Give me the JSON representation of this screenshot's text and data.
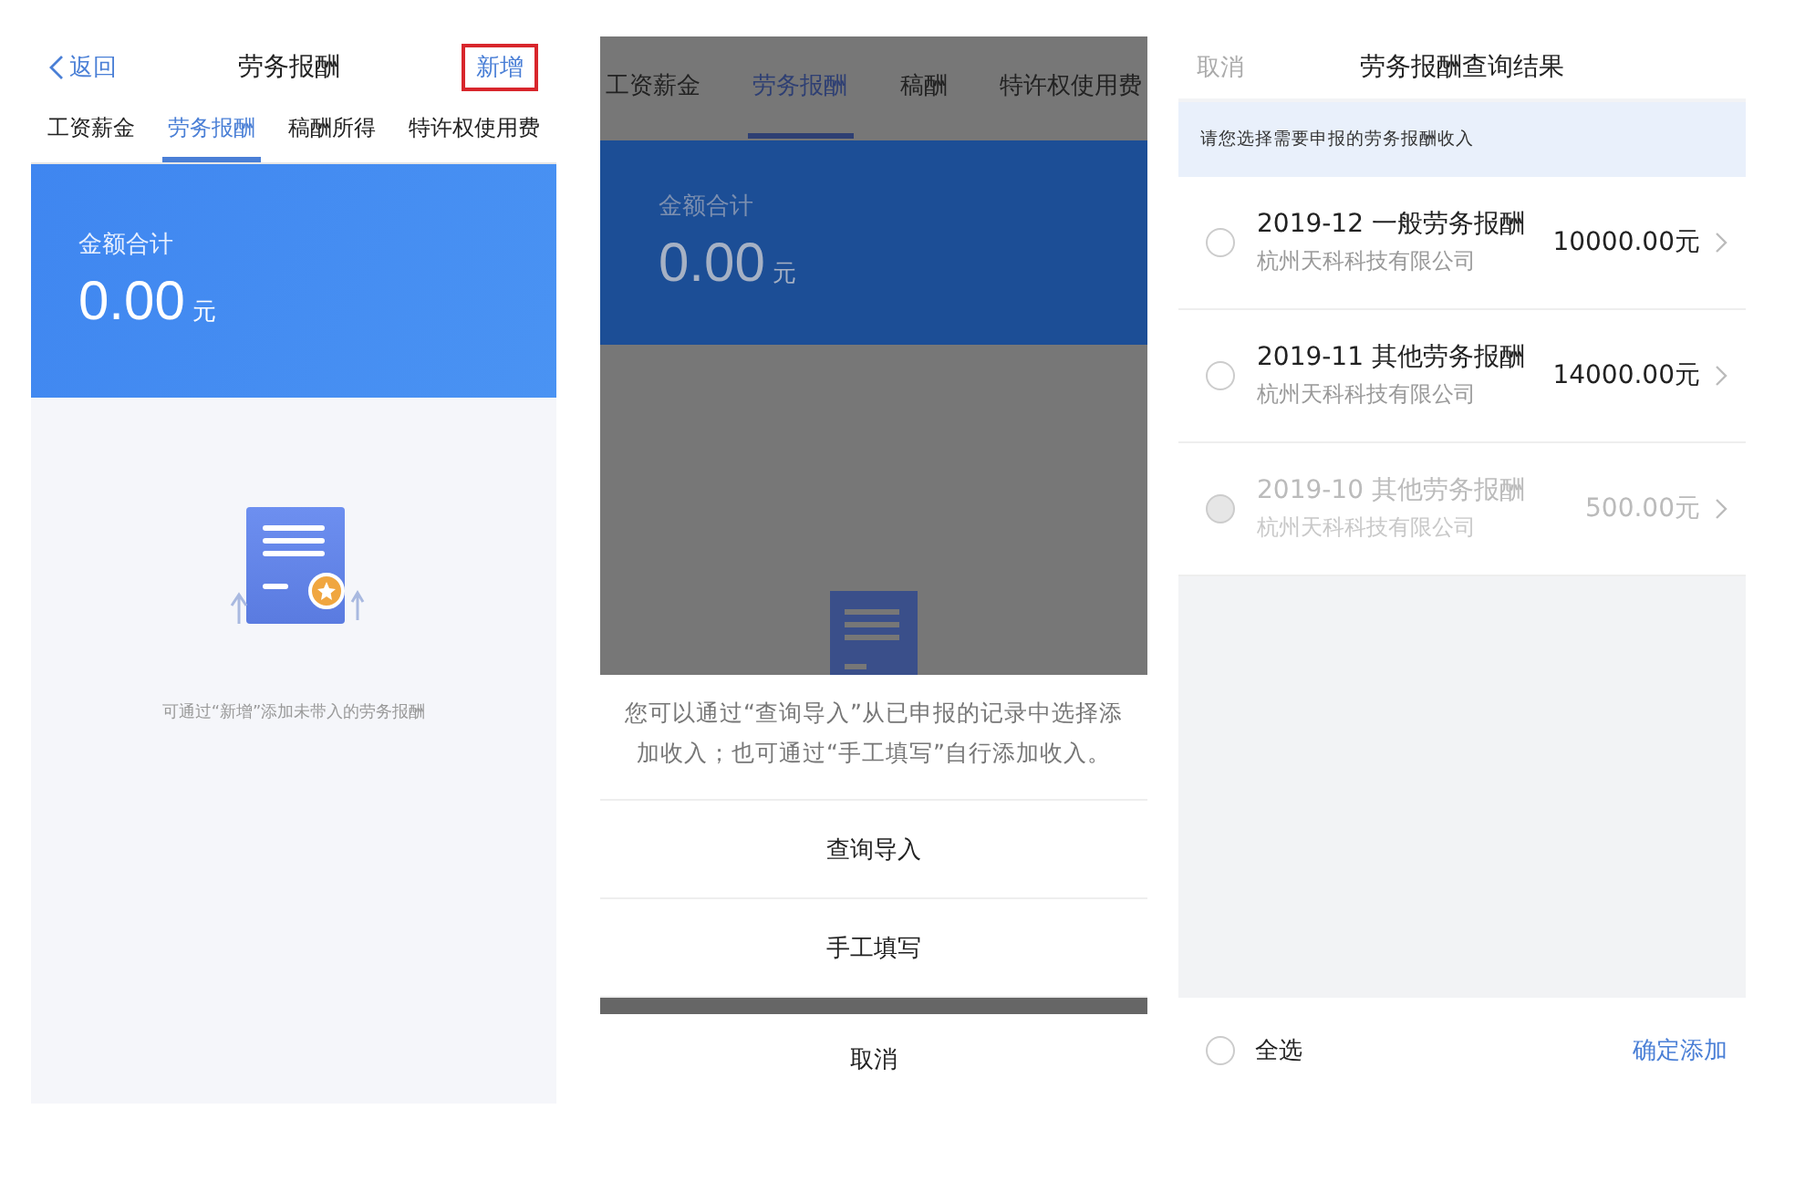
{
  "left_screen": {
    "nav": {
      "back": "返回",
      "title": "劳务报酬",
      "action": "新增",
      "action_highlighted": true
    },
    "tabs": [
      {
        "label": "工资薪金",
        "selected": false
      },
      {
        "label": "劳务报酬",
        "selected": true
      },
      {
        "label": "稿酬所得",
        "selected": false
      },
      {
        "label": "特许权使用费",
        "selected": false
      }
    ],
    "summary": {
      "label": "金额合计",
      "amount": "0.00",
      "unit": "元"
    },
    "empty_hint": "可通过“新增”添加未带入的劳务报酬"
  },
  "middle_screen": {
    "tabs": [
      {
        "label": "工资薪金",
        "selected": false
      },
      {
        "label": "劳务报酬",
        "selected": true
      },
      {
        "label": "稿酬",
        "selected": false
      },
      {
        "label": "特许权使用费",
        "selected": false
      }
    ],
    "summary": {
      "label": "金额合计",
      "amount": "0.00",
      "unit": "元"
    },
    "sheet": {
      "message": "您可以通过“查询导入”从已申报的记录中选择添加收入；也可通过“手工填写”自行添加收入。",
      "options": [
        "查询导入",
        "手工填写"
      ],
      "cancel": "取消"
    }
  },
  "right_screen": {
    "nav": {
      "cancel": "取消",
      "title": "劳务报酬查询结果"
    },
    "hint": "请您选择需要申报的劳务报酬收入",
    "records": [
      {
        "title": "2019-12 一般劳务报酬",
        "company": "杭州天科科技有限公司",
        "amount": "10000.00元",
        "checked": false,
        "disabled": false
      },
      {
        "title": "2019-11 其他劳务报酬",
        "company": "杭州天科科技有限公司",
        "amount": "14000.00元",
        "checked": false,
        "disabled": false
      },
      {
        "title": "2019-10 其他劳务报酬",
        "company": "杭州天科科技有限公司",
        "amount": "500.00元",
        "checked": false,
        "disabled": true
      }
    ],
    "select_all": {
      "label": "全选",
      "checked": false
    },
    "confirm": "确定添加"
  }
}
